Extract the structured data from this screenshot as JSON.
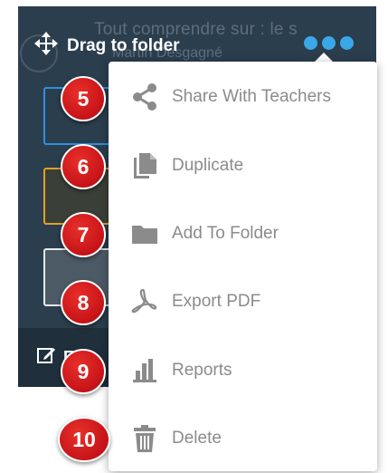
{
  "card": {
    "drag_label": "Drag to folder",
    "title_ghost": "Tout comprendre sur : le s",
    "subtitle_ghost": "Martin Desgagné",
    "edit_label": "Edit"
  },
  "menu": {
    "items": [
      {
        "label": "Share With Teachers",
        "icon": "share-icon",
        "badge": "5"
      },
      {
        "label": "Duplicate",
        "icon": "duplicate-icon",
        "badge": "6"
      },
      {
        "label": "Add To Folder",
        "icon": "folder-icon",
        "badge": "7"
      },
      {
        "label": "Export PDF",
        "icon": "pdf-icon",
        "badge": "8"
      },
      {
        "label": "Reports",
        "icon": "bar-chart-icon",
        "badge": "9"
      },
      {
        "label": "Delete",
        "icon": "trash-icon",
        "badge": "10"
      }
    ]
  },
  "colors": {
    "card_bg": "#2b3e4e",
    "accent_blue": "#3aa7e8",
    "badge_red": "#c9151a",
    "icon_gray": "#8b8b8b"
  }
}
